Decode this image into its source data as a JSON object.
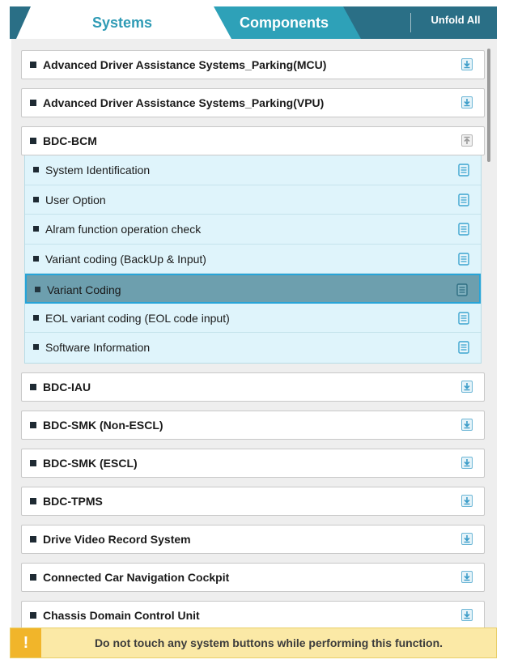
{
  "tabs": {
    "systems_label": "Systems",
    "components_label": "Components",
    "unfold_all_label": "Unfold All",
    "active": "Systems"
  },
  "systems": [
    {
      "label": "Advanced Driver Assistance Systems_Parking(MCU)",
      "icon": "download-icon"
    },
    {
      "label": "Advanced Driver Assistance Systems_Parking(VPU)",
      "icon": "download-icon"
    },
    {
      "label": "BDC-BCM",
      "icon": "collapse-icon",
      "expanded": true,
      "functions": [
        {
          "label": "System Identification"
        },
        {
          "label": "User Option"
        },
        {
          "label": "Alram function operation check"
        },
        {
          "label": "Variant coding (BackUp & Input)"
        },
        {
          "label": "Variant Coding",
          "selected": true
        },
        {
          "label": "EOL variant coding (EOL code input)"
        },
        {
          "label": "Software Information"
        }
      ]
    },
    {
      "label": "BDC-IAU",
      "icon": "download-icon"
    },
    {
      "label": "BDC-SMK (Non-ESCL)",
      "icon": "download-icon"
    },
    {
      "label": "BDC-SMK (ESCL)",
      "icon": "download-icon"
    },
    {
      "label": "BDC-TPMS",
      "icon": "download-icon"
    },
    {
      "label": "Drive Video Record System",
      "icon": "download-icon"
    },
    {
      "label": "Connected Car Navigation Cockpit",
      "icon": "download-icon"
    },
    {
      "label": "Chassis Domain Control Unit",
      "icon": "download-icon"
    }
  ],
  "warning": {
    "icon_text": "!",
    "message": "Do not touch any system buttons while performing this function."
  },
  "colors": {
    "header_bg": "#2a6f86",
    "active_tab_text": "#2f9bb5",
    "sub_row_bg": "#dff4fb",
    "selected_row_bg": "#6d9fae",
    "selected_border": "#27a4d8",
    "warning_bg": "#fbe9a6",
    "warning_icon_bg": "#f1b52a"
  }
}
